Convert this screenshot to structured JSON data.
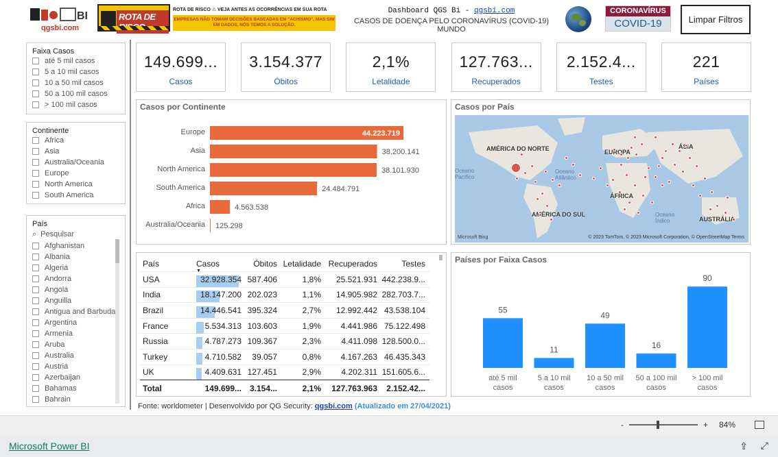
{
  "header": {
    "logo_name": "qgsbi.com",
    "rota_label": "ROTA DE RISCO",
    "rota_line1": "ROTA DE RISCO ⚠ VEJA ANTES AS OCORRÊNCIAS EM SUA ROTA",
    "rota_line2": "EMPRESAS NÃO TOMAM DECISÕES BASEADAS EM \"ACHISMO\", MAS SIM EM DADOS, NÓS TEMOS A SOLUÇÃO.",
    "dash_prefix": "Dashboard QGS Bi - ",
    "dash_link": "qgsbi.com",
    "subtitle": "CASOS DE DOENÇA PELO CORONAVÍRUS (COVID-19) MUNDO",
    "badge_top": "CORONAVÍRUS",
    "badge_bottom": "COVID-19",
    "clear_button": "Limpar Filtros"
  },
  "slicers": {
    "faixa": {
      "title": "Faixa Casos",
      "items": [
        "até 5 mil casos",
        "5 a 10 mil casos",
        "10 a 50 mil casos",
        "50 a 100 mil casos",
        "> 100 mil casos"
      ]
    },
    "continente": {
      "title": "Continente",
      "items": [
        "Africa",
        "Asia",
        "Australia/Oceania",
        "Europe",
        "North America",
        "South America"
      ]
    },
    "pais": {
      "title": "País",
      "search_placeholder": "Pesquisar",
      "items": [
        "Afghanistan",
        "Albania",
        "Algeria",
        "Andorra",
        "Angola",
        "Anguilla",
        "Antigua and Barbuda",
        "Argentina",
        "Armenia",
        "Aruba",
        "Australia",
        "Austria",
        "Azerbaijan",
        "Bahamas",
        "Bahrain"
      ]
    }
  },
  "kpis": [
    {
      "value": "149.699...",
      "label": "Casos"
    },
    {
      "value": "3.154.377",
      "label": "Óbitos"
    },
    {
      "value": "2,1%",
      "label": "Letalidade"
    },
    {
      "value": "127.763...",
      "label": "Recuperados"
    },
    {
      "value": "2.152.4...",
      "label": "Testes"
    },
    {
      "value": "221",
      "label": "Países"
    }
  ],
  "continent_panel": {
    "title": "Casos por Continente"
  },
  "map_panel": {
    "title": "Casos por País",
    "labels": {
      "na": "AMÉRICA DO NORTE",
      "eu": "EUROPA",
      "as": "ÁSIA",
      "af": "ÁFRICA",
      "sa": "AMÉRICA DO SUL",
      "au": "AUSTRÁLIA",
      "op": "Oceano Pacífico",
      "oa": "Oceano Atlântico",
      "oi": "Oceano Índico"
    },
    "attribution": "© 2023 TomTom, © 2023 Microsoft Corporation, © OpenStreetMap  Terms",
    "bing": "Microsoft Bing"
  },
  "table": {
    "headers": [
      "País",
      "Casos",
      "Óbitos",
      "Letalidade",
      "Recuperados",
      "Testes"
    ],
    "rows": [
      {
        "pais": "USA",
        "casos": "32.928.354",
        "obitos": "587.406",
        "let": "1,8%",
        "rec": "25.521.931",
        "testes": "442.238.9...",
        "frac": 1.0
      },
      {
        "pais": "India",
        "casos": "18.147.200",
        "obitos": "202.023",
        "let": "1,1%",
        "rec": "14.905.982",
        "testes": "282.703.7...",
        "frac": 0.55
      },
      {
        "pais": "Brazil",
        "casos": "14.446.541",
        "obitos": "395.324",
        "let": "2,7%",
        "rec": "12.992.442",
        "testes": "43.538.104",
        "frac": 0.44
      },
      {
        "pais": "France",
        "casos": "5.534.313",
        "obitos": "103.603",
        "let": "1,9%",
        "rec": "4.441.986",
        "testes": "75.122.498",
        "frac": 0.17
      },
      {
        "pais": "Russia",
        "casos": "4.787.273",
        "obitos": "109.367",
        "let": "2,3%",
        "rec": "4.411.098",
        "testes": "128.500.0...",
        "frac": 0.145
      },
      {
        "pais": "Turkey",
        "casos": "4.710.582",
        "obitos": "39.057",
        "let": "0,8%",
        "rec": "4.167.263",
        "testes": "46.435.343",
        "frac": 0.143
      },
      {
        "pais": "UK",
        "casos": "4.409.631",
        "obitos": "127.451",
        "let": "2,9%",
        "rec": "4.202.311",
        "testes": "151.605.6...",
        "frac": 0.134
      }
    ],
    "total": {
      "pais": "Total",
      "casos": "149.699...",
      "obitos": "3.154...",
      "let": "2,1%",
      "rec": "127.763.963",
      "testes": "2.152.42..."
    }
  },
  "faixa_panel": {
    "title": "Países por Faixa Casos"
  },
  "footer": {
    "source_text": "Fonte: worldometer | Desenvolvido por QG Security: ",
    "source_link": "qgsbi.com",
    "updated": " (Atualizado em 27/04/2021)",
    "zoom": "84%",
    "zoom_minus": "-",
    "zoom_plus": "+",
    "powerbi_link": "Microsoft Power BI"
  },
  "chart_data": [
    {
      "type": "bar",
      "orientation": "horizontal",
      "title": "Casos por Continente",
      "categories": [
        "Europe",
        "Asia",
        "North America",
        "South America",
        "Africa",
        "Australia/Oceania"
      ],
      "values": [
        44223719,
        38200141,
        38101930,
        24484791,
        4563538,
        125298
      ],
      "labels": [
        "44.223.719",
        "38.200.141",
        "38.101.930",
        "24.484.791",
        "4.563.538",
        "125.298"
      ],
      "color": "#e8693a"
    },
    {
      "type": "bar",
      "title": "Países por Faixa Casos",
      "categories": [
        "até 5 mil casos",
        "5 a 10 mil casos",
        "10 a 50 mil casos",
        "50 a 100 mil casos",
        "> 100 mil casos"
      ],
      "values": [
        55,
        11,
        49,
        16,
        90
      ],
      "color": "#1e90ff"
    }
  ]
}
